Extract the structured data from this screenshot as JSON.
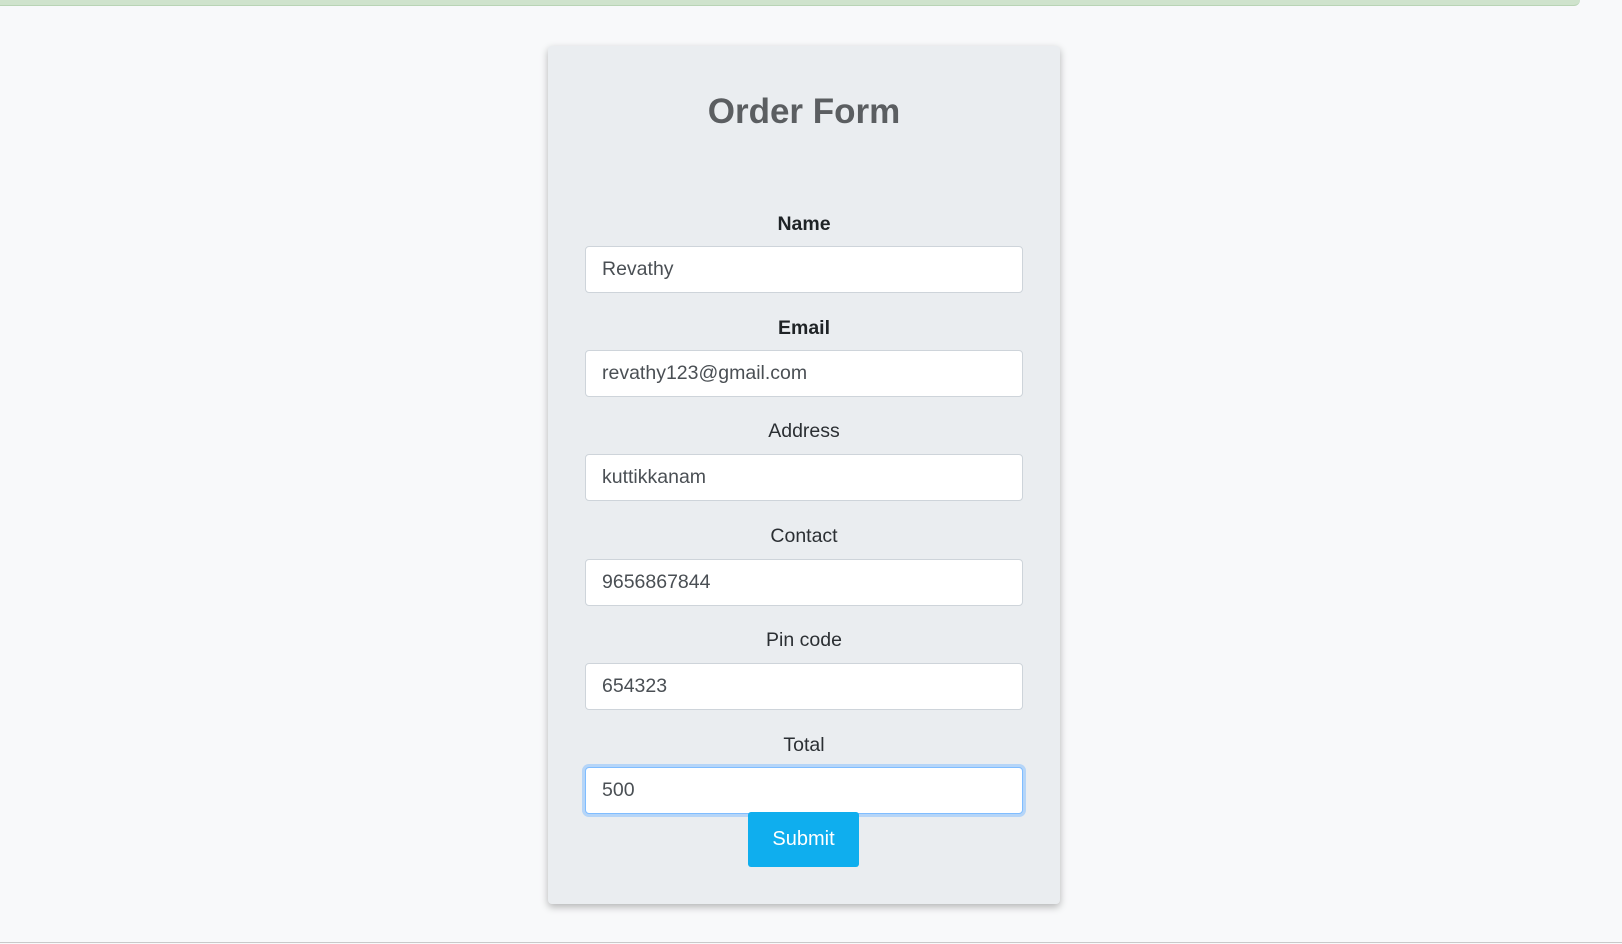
{
  "form": {
    "title": "Order Form",
    "fields": [
      {
        "label": "Name",
        "value": "Revathy"
      },
      {
        "label": "Email",
        "value": "revathy123@gmail.com"
      },
      {
        "label": "Address",
        "value": "kuttikkanam"
      },
      {
        "label": "Contact",
        "value": "9656867844"
      },
      {
        "label": "Pin code",
        "value": "654323"
      },
      {
        "label": "Total",
        "value": "500"
      }
    ],
    "submit_label": "Submit"
  },
  "colors": {
    "page_background": "#f8f9fa",
    "card_background": "#eaedf0",
    "title": "#5b5e61",
    "submit_button": "#0faeee",
    "focus_ring": "#80bdff"
  }
}
